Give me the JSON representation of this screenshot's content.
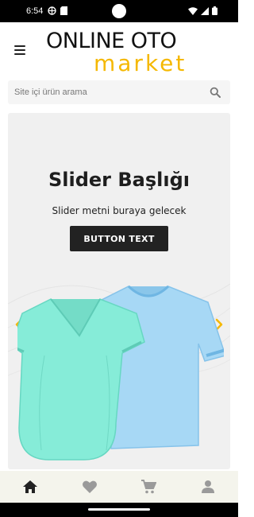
{
  "status_bar": {
    "time": "6:54"
  },
  "header": {
    "logo_line1": "ONLINE OTO",
    "logo_line2": "market"
  },
  "search": {
    "placeholder": "Site içi ürün arama"
  },
  "slider": {
    "title": "Slider Başlığı",
    "text": "Slider metni buraya gelecek",
    "button_label": "BUTTON TEXT"
  },
  "colors": {
    "accent": "#f5b800",
    "button": "#222222",
    "nav_background": "#f4f4ec"
  },
  "bottom_nav": {
    "items": [
      {
        "icon": "home-icon",
        "active": true
      },
      {
        "icon": "heart-icon",
        "active": false
      },
      {
        "icon": "cart-icon",
        "active": false
      },
      {
        "icon": "person-icon",
        "active": false
      }
    ]
  }
}
